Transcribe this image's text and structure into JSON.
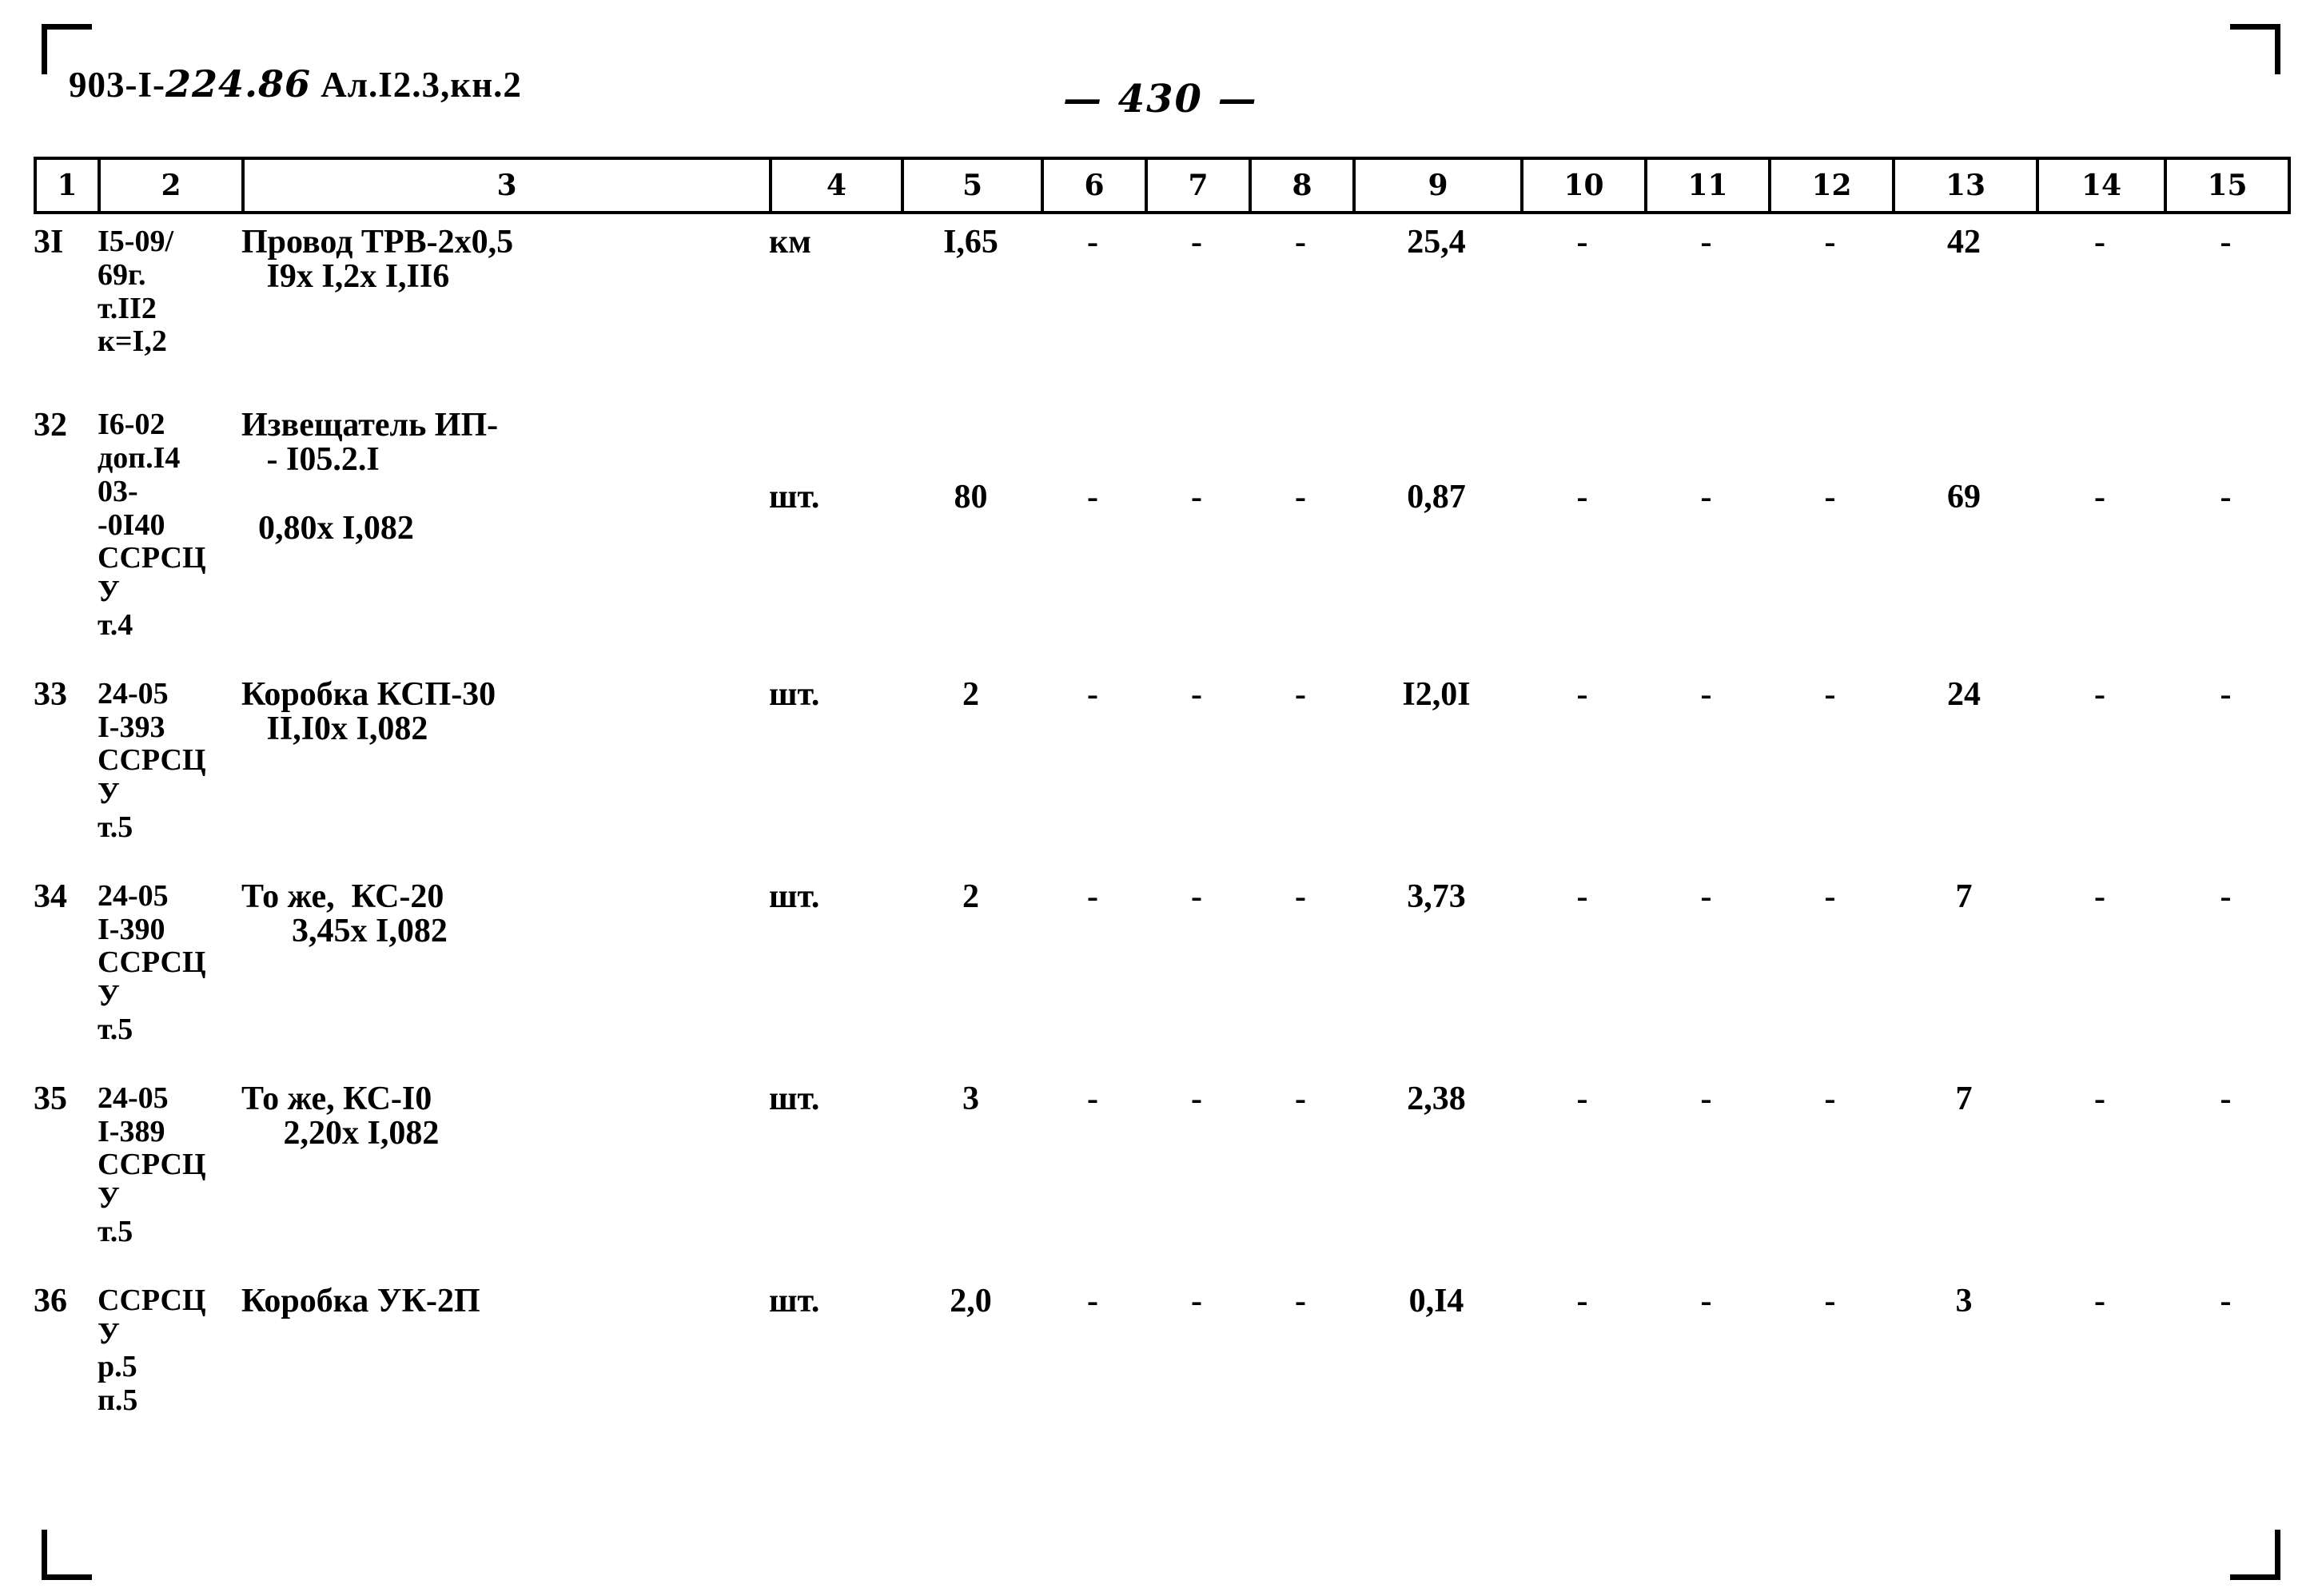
{
  "document": {
    "header_code": "903-I-",
    "header_code_hand": "224.86",
    "header_suffix": "Ал.I2.3,кн.2",
    "page_number": "— 430 —"
  },
  "table": {
    "column_headers": [
      "1",
      "2",
      "3",
      "4",
      "5",
      "6",
      "7",
      "8",
      "9",
      "10",
      "11",
      "12",
      "13",
      "14",
      "15"
    ],
    "rows": [
      {
        "pos": "3I",
        "code": "I5-09/\n69г.\nт.II2\nк=I,2",
        "name": "Провод ТРВ-2х0,5\n   I9х I,2х I,II6",
        "unit": "км",
        "c5": "I,65",
        "c6": "-",
        "c7": "-",
        "c8": "-",
        "c9": "25,4",
        "c10": "-",
        "c11": "-",
        "c12": "-",
        "c13": "42",
        "c14": "-",
        "c15": "-"
      },
      {
        "pos": "32",
        "code": "I6-02\nдоп.I4\n03-\n-0I40\nССРСЦ\nУ\nт.4",
        "name": "Извещатель ИП-\n   - I05.2.I\n\n  0,80х I,082",
        "unit": "шт.",
        "c5": "80",
        "c6": "-",
        "c7": "-",
        "c8": "-",
        "c9": "0,87",
        "c10": "-",
        "c11": "-",
        "c12": "-",
        "c13": "69",
        "c14": "-",
        "c15": "-"
      },
      {
        "pos": "33",
        "code": "24-05\nI-393\nССРСЦ\nУ\nт.5",
        "name": "Коробка КСП-30\n   II,I0х I,082",
        "unit": "шт.",
        "c5": "2",
        "c6": "-",
        "c7": "-",
        "c8": "-",
        "c9": "I2,0I",
        "c10": "-",
        "c11": "-",
        "c12": "-",
        "c13": "24",
        "c14": "-",
        "c15": "-"
      },
      {
        "pos": "34",
        "code": "24-05\nI-390\nССРСЦ\nУ\nт.5",
        "name": "То же,  КС-20\n      3,45х I,082",
        "unit": "шт.",
        "c5": "2",
        "c6": "-",
        "c7": "-",
        "c8": "-",
        "c9": "3,73",
        "c10": "-",
        "c11": "-",
        "c12": "-",
        "c13": "7",
        "c14": "-",
        "c15": "-"
      },
      {
        "pos": "35",
        "code": "24-05\nI-389\nССРСЦ\nУ\nт.5",
        "name": "То же, КС-I0\n     2,20х I,082",
        "unit": "шт.",
        "c5": "3",
        "c6": "-",
        "c7": "-",
        "c8": "-",
        "c9": "2,38",
        "c10": "-",
        "c11": "-",
        "c12": "-",
        "c13": "7",
        "c14": "-",
        "c15": "-"
      },
      {
        "pos": "36",
        "code": "ССРСЦ\nУ\nр.5\nп.5",
        "name": "Коробка УК-2П",
        "unit": "шт.",
        "c5": "2,0",
        "c6": "-",
        "c7": "-",
        "c8": "-",
        "c9": "0,I4",
        "c10": "-",
        "c11": "-",
        "c12": "-",
        "c13": "3",
        "c14": "-",
        "c15": "-"
      }
    ]
  }
}
